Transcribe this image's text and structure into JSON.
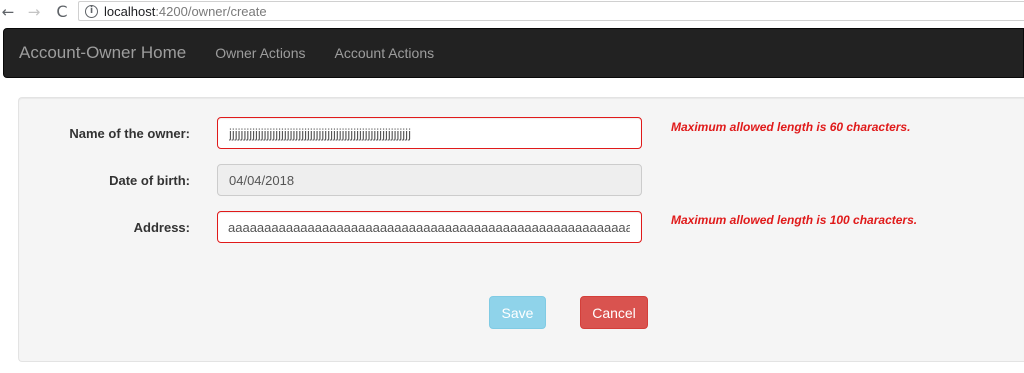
{
  "browser": {
    "back_icon": "←",
    "forward_icon": "→",
    "reload_icon": "C",
    "info_icon": "i",
    "url_host": "localhost",
    "url_path": ":4200/owner/create"
  },
  "navbar": {
    "brand": "Account-Owner Home",
    "links": [
      "Owner Actions",
      "Account Actions"
    ]
  },
  "form": {
    "name": {
      "label": "Name of the owner:",
      "value": "jjjjjjjjjjjjjjjjjjjjjjjjjjjjjjjjjjjjjjjjjjjjjjjjjjjjjjjjjjjjjjj",
      "error": "Maximum allowed length is 60 characters."
    },
    "dob": {
      "label": "Date of birth:",
      "value": "04/04/2018"
    },
    "address": {
      "label": "Address:",
      "value": "aaaaaaaaaaaaaaaaaaaaaaaaaaaaaaaaaaaaaaaaaaaaaaaaaaaaaaaaaa",
      "error": "Maximum allowed length is 100 characters."
    },
    "save_label": "Save",
    "cancel_label": "Cancel"
  },
  "colors": {
    "error": "#e01a1a",
    "navbar_bg": "#222222",
    "save_disabled": "#8fd3ea",
    "cancel": "#d9534f"
  }
}
